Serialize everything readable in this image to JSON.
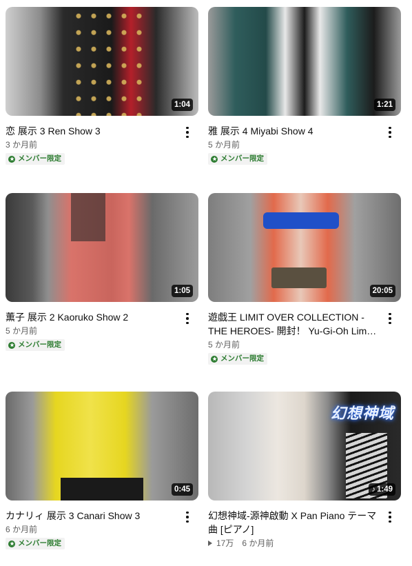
{
  "videos": [
    {
      "title": "恋 展示 3 Ren Show 3",
      "duration": "1:04",
      "age": "3 か月前",
      "badge": "メンバー限定",
      "colors": [
        "#2a2a2a",
        "#b3202a",
        "#d4b25a"
      ]
    },
    {
      "title": "雅 展示 4 Miyabi Show 4",
      "duration": "1:21",
      "age": "5 か月前",
      "badge": "メンバー限定",
      "colors": [
        "#2f5d5c",
        "#e8e8e8",
        "#1c1c1c"
      ]
    },
    {
      "title": "薫子 展示 2 Kaoruko Show 2",
      "duration": "1:05",
      "age": "5 か月前",
      "badge": "メンバー限定",
      "colors": [
        "#5a5a5a",
        "#d9736a",
        "#2b2b2b"
      ]
    },
    {
      "title": "遊戯王 LIMIT OVER COLLECTION -THE HEROES- 開封！ Yu-Gi-Oh Limit Over Collection",
      "duration": "20:05",
      "age": "5 か月前",
      "badge": "メンバー限定",
      "colors": [
        "#8a8a8a",
        "#2050c8",
        "#e26a4c"
      ]
    },
    {
      "title": "カナリィ 展示 3 Canari Show 3",
      "duration": "0:45",
      "age": "6 か月前",
      "badge": "メンバー限定",
      "colors": [
        "#7a7a7a",
        "#e6d620",
        "#1a1a1a"
      ]
    },
    {
      "title": "幻想神域-源神啟動 X Pan Piano テーマ曲 [ピアノ]",
      "duration": "1:49",
      "views": "17万",
      "age": "6 か月前",
      "overlay": "幻想神域",
      "colors": [
        "#c8c8c8",
        "#ece7e0",
        "#1a1a1a"
      ]
    }
  ]
}
